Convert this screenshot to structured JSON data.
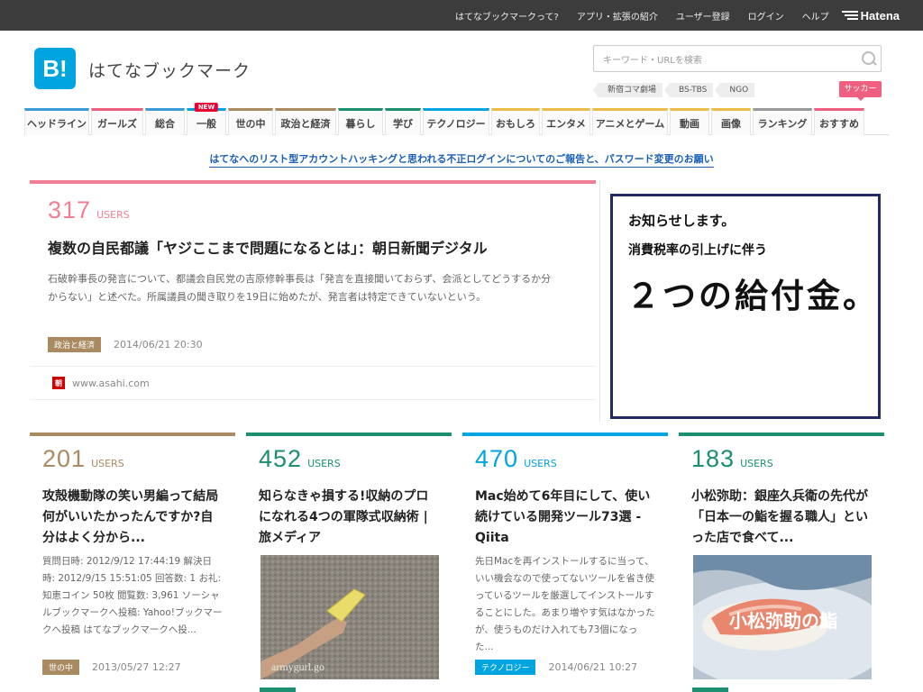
{
  "topbar": {
    "links": [
      "はてなブックマークって?",
      "アプリ・拡張の紹介",
      "ユーザー登録",
      "ログイン",
      "ヘルプ"
    ],
    "brand": "Hatena"
  },
  "header": {
    "logo_text": "B!",
    "site_title": "はてなブックマーク",
    "search_placeholder": "キーワード・URLを検索",
    "trending_tags": [
      "新宿コマ劇場",
      "BS-TBS",
      "NGO"
    ],
    "badge": "サッカー"
  },
  "nav": {
    "items": [
      {
        "label": "ヘッドライン",
        "color": "#3a9bd5",
        "w": 72
      },
      {
        "label": "ガールズ",
        "color": "#ef6080",
        "w": 58
      },
      {
        "label": "総合",
        "color": "#3a9bd5",
        "w": 44
      },
      {
        "label": "一般",
        "color": "#00a4de",
        "w": 44,
        "new": "NEW"
      },
      {
        "label": "世の中",
        "color": "#a98a61",
        "w": 50
      },
      {
        "label": "政治と経済",
        "color": "#a98a61",
        "w": 68
      },
      {
        "label": "暮らし",
        "color": "#1b8f70",
        "w": 50
      },
      {
        "label": "学び",
        "color": "#1b8f70",
        "w": 40
      },
      {
        "label": "テクノロジー",
        "color": "#00a4de",
        "w": 74
      },
      {
        "label": "おもしろ",
        "color": "#ecbb4a",
        "w": 54
      },
      {
        "label": "エンタメ",
        "color": "#ecbb4a",
        "w": 54
      },
      {
        "label": "アニメとゲーム",
        "color": "#ecbb4a",
        "w": 84
      },
      {
        "label": "動画",
        "color": "#ecbb4a",
        "w": 44
      },
      {
        "label": "画像",
        "color": "#ecbb4a",
        "w": 44
      },
      {
        "label": "ランキング",
        "color": "#999999",
        "w": 66
      },
      {
        "label": "おすすめ",
        "color": "#ef6080",
        "w": 56
      }
    ]
  },
  "notice": "はてなへのリスト型アカウントハッキングと思われる不正ログインについてのご報告と、パスワード変更のお願い",
  "main_entry": {
    "users": "317",
    "users_label": "USERS",
    "title": "複数の自民都議「ヤジここまで問題になるとは」：朝日新聞デジタル",
    "description": "石破幹事長の発言について、都議会自民党の吉原修幹事長は「発言を直接聞いておらず、会派としてどうするか分からない」と述べた。所属議員の聞き取りを19日に始めたが、発言者は特定できていないという。",
    "category": "政治と経済",
    "category_color": "#a98a61",
    "date": "2014/06/21 20:30",
    "favicon": "朝",
    "source": "www.asahi.com"
  },
  "ad": {
    "line1": "お知らせします。",
    "line2": "消費税率の引上げに伴う",
    "line3": "２つの給付金。"
  },
  "entries": [
    {
      "users": "201",
      "users_label": "USERS",
      "title": "攻殻機動隊の笑い男編って結局何がいいたかったんですか?自分はよく分から...",
      "description": "質問日時: 2012/9/12 17:44:19 解決日時: 2012/9/15 15:51:05 回答数: 1 お礼: 知恵コイン 50枚 閲覧数: 3,961 ソーシャルブックマークへ投稿: Yahoo!ブックマークへ投稿 はてなブックマークへ投...",
      "category": "世の中",
      "category_color": "#a98a61",
      "date": "2013/05/27 12:27"
    },
    {
      "users": "452",
      "users_label": "USERS",
      "title": "知らなきゃ損する!収納のプロになれる4つの軍隊式収納術 | 旅メディア",
      "image_caption": "armygurl.go"
    },
    {
      "users": "470",
      "users_label": "USERS",
      "title": "Mac始めて6年目にして、使い続けている開発ツール73選 - Qiita",
      "description": "先日Macを再インストールするに当って、いい機会なので使ってないツールを省き使っているツールを厳選してインストールすることにした。あまり増やす気はなかったが、使うものだけ入れても73個になった...",
      "category": "テクノロジー",
      "category_color": "#00a4de",
      "date": "2014/06/21 10:27"
    },
    {
      "users": "183",
      "users_label": "USERS",
      "title": "小松弥助：銀座久兵衛の先代が「日本一の鮨を握る職人」といった店で食べて...",
      "image_caption": "小松弥助の鮨"
    }
  ]
}
